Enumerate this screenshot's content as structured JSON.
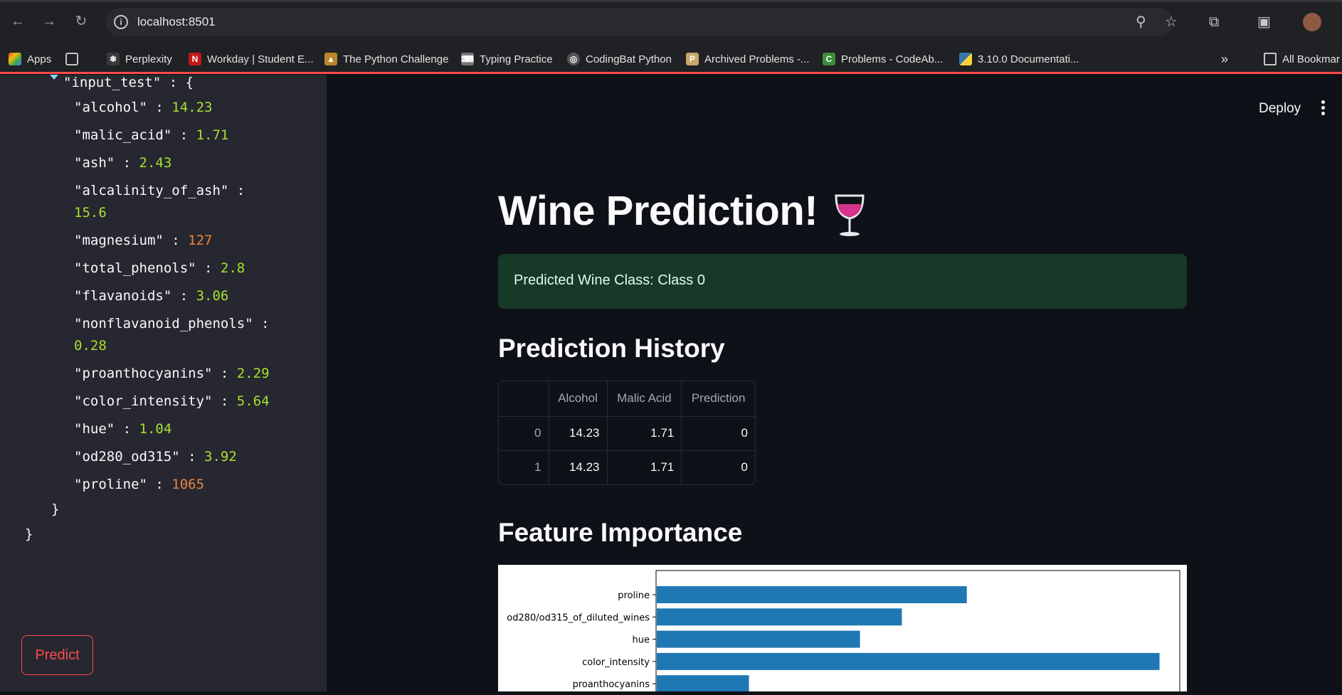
{
  "browser": {
    "url": "localhost:8501",
    "bookmarks": [
      {
        "label": "Apps",
        "icon": "apps-grid-icon"
      },
      {
        "label": "",
        "icon": "grid-icon"
      },
      {
        "label": "Perplexity",
        "icon": "perplexity-icon"
      },
      {
        "label": "Workday | Student E...",
        "icon": "workday-icon"
      },
      {
        "label": "The Python Challenge",
        "icon": "python-challenge-icon"
      },
      {
        "label": "Typing Practice",
        "icon": "typing-icon"
      },
      {
        "label": "CodingBat Python",
        "icon": "globe-icon"
      },
      {
        "label": "Archived Problems -...",
        "icon": "project-euler-icon"
      },
      {
        "label": "Problems - CodeAb...",
        "icon": "codeabbey-icon"
      },
      {
        "label": "3.10.0 Documentati...",
        "icon": "python-icon"
      }
    ],
    "all_bookmarks": "All Bookmar"
  },
  "sidebar": {
    "json_root_key": "\"input_test\"",
    "fields": [
      {
        "key": "\"alcohol\"",
        "value": "14.23",
        "type": "float"
      },
      {
        "key": "\"malic_acid\"",
        "value": "1.71",
        "type": "float"
      },
      {
        "key": "\"ash\"",
        "value": "2.43",
        "type": "float"
      },
      {
        "key": "\"alcalinity_of_ash\"",
        "value": "15.6",
        "type": "float",
        "wrap": true
      },
      {
        "key": "\"magnesium\"",
        "value": "127",
        "type": "int"
      },
      {
        "key": "\"total_phenols\"",
        "value": "2.8",
        "type": "float"
      },
      {
        "key": "\"flavanoids\"",
        "value": "3.06",
        "type": "float"
      },
      {
        "key": "\"nonflavanoid_phenols\"",
        "value": "0.28",
        "type": "float",
        "wrap": true
      },
      {
        "key": "\"proanthocyanins\"",
        "value": "2.29",
        "type": "float"
      },
      {
        "key": "\"color_intensity\"",
        "value": "5.64",
        "type": "float"
      },
      {
        "key": "\"hue\"",
        "value": "1.04",
        "type": "float"
      },
      {
        "key": "\"od280_od315\"",
        "value": "3.92",
        "type": "float"
      },
      {
        "key": "\"proline\"",
        "value": "1065",
        "type": "int"
      }
    ],
    "predict_label": "Predict"
  },
  "main": {
    "deploy_label": "Deploy",
    "title": "Wine Prediction!",
    "title_icon": "wine-glass-icon",
    "success_text": "Predicted Wine Class: Class 0",
    "history_heading": "Prediction History",
    "history_table": {
      "columns": [
        "",
        "Alcohol",
        "Malic Acid",
        "Prediction"
      ],
      "rows": [
        [
          "0",
          "14.23",
          "1.71",
          "0"
        ],
        [
          "1",
          "14.23",
          "1.71",
          "0"
        ]
      ]
    },
    "importance_heading": "Feature Importance"
  },
  "colors": {
    "accent": "#ff4b4b",
    "bar": "#1f77b4",
    "success_bg": "#173928"
  },
  "chart_data": {
    "type": "bar",
    "orientation": "horizontal",
    "categories": [
      "proline",
      "od280/od315_of_diluted_wines",
      "hue",
      "color_intensity",
      "proanthocyanins"
    ],
    "values": [
      0.148,
      0.117,
      0.097,
      0.24,
      0.044
    ],
    "xlim": [
      0,
      0.25
    ],
    "title": "",
    "xlabel": "",
    "ylabel": "",
    "note": "partially visible; bottom cut off"
  }
}
